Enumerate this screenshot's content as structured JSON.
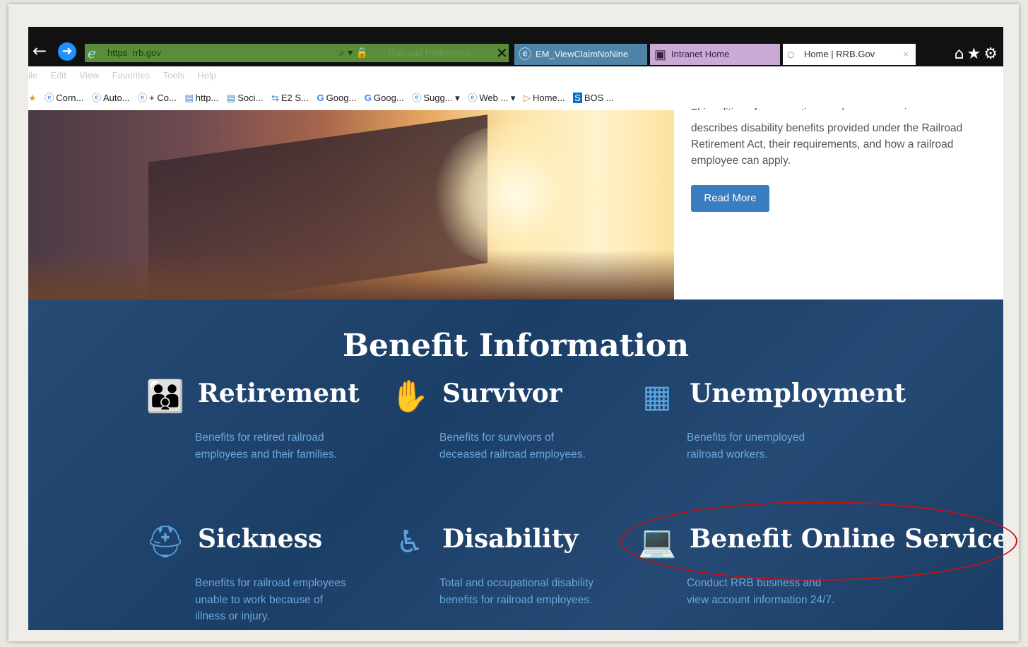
{
  "browser": {
    "url_scheme": "https",
    "url_host": "rrb.gov",
    "site_identity": "Railroad Retirement",
    "tabs": [
      {
        "label": "EM_ViewClaimNoNine",
        "icon": "ie-icon"
      },
      {
        "label": "Intranet Home",
        "icon": "intranet-icon"
      },
      {
        "label": "Home | RRB.Gov",
        "icon": "loading-icon"
      }
    ],
    "tab_close": "×",
    "menu": [
      "File",
      "Edit",
      "View",
      "Favorites",
      "Tools",
      "Help"
    ],
    "favorites": [
      "Corn...",
      "Auto...",
      "+ Co...",
      "http...",
      "Soci...",
      "E2 S...",
      "Goog...",
      "Goog...",
      "Sugg...",
      "Web ...",
      "Home...",
      "BOS ..."
    ]
  },
  "hero": {
    "cut_line": "This edition of our questions and answers series",
    "text": "describes disability benefits provided under the Railroad Retirement Act, their requirements, and how a railroad employee can apply.",
    "button": "Read More"
  },
  "benefit": {
    "title": "Benefit Information",
    "items": [
      {
        "title": "Retirement",
        "desc": "Benefits for retired railroad employees and their families.",
        "icon": "family-icon"
      },
      {
        "title": "Survivor",
        "desc": "Benefits for survivors of deceased railroad employees.",
        "icon": "hands-family-icon"
      },
      {
        "title": "Unemployment",
        "desc": "Benefits for unemployed railroad workers.",
        "icon": "calendar-money-icon"
      },
      {
        "title": "Sickness",
        "desc": "Benefits for railroad employees unable to work because of illness or injury.",
        "icon": "nurse-icon"
      },
      {
        "title": "Disability",
        "desc": "Total and occupational disability benefits for railroad employees.",
        "icon": "wheelchair-icon"
      },
      {
        "title": "Benefit Online Services",
        "desc": "Conduct RRB business and view account information 24/7.",
        "icon": "person-laptop-icon"
      }
    ]
  },
  "annotation_color": "#c41212"
}
